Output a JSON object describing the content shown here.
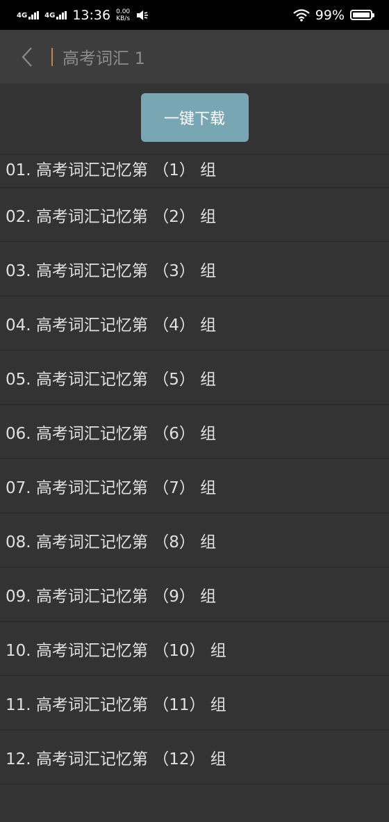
{
  "status_bar": {
    "network_1": "4G",
    "network_2": "4G",
    "time": "13:36",
    "speed_value": "0.00",
    "speed_unit": "KB/s",
    "battery": "99%",
    "battery_level": 0.99
  },
  "header": {
    "title": "高考词汇 1"
  },
  "toolbar": {
    "download_label": "一键下载"
  },
  "colors": {
    "accent_button": "#78a7b3",
    "divider_accent": "#c8834a",
    "background": "#333333"
  },
  "lessons": [
    "01. 高考词汇记忆第 （1） 组",
    "02. 高考词汇记忆第 （2） 组",
    "03. 高考词汇记忆第 （3） 组",
    "04. 高考词汇记忆第 （4） 组",
    "05. 高考词汇记忆第 （5） 组",
    "06. 高考词汇记忆第 （6） 组",
    "07. 高考词汇记忆第 （7） 组",
    "08. 高考词汇记忆第 （8） 组",
    "09. 高考词汇记忆第 （9） 组",
    "10. 高考词汇记忆第 （10） 组",
    "11. 高考词汇记忆第 （11） 组",
    "12. 高考词汇记忆第 （12） 组"
  ]
}
